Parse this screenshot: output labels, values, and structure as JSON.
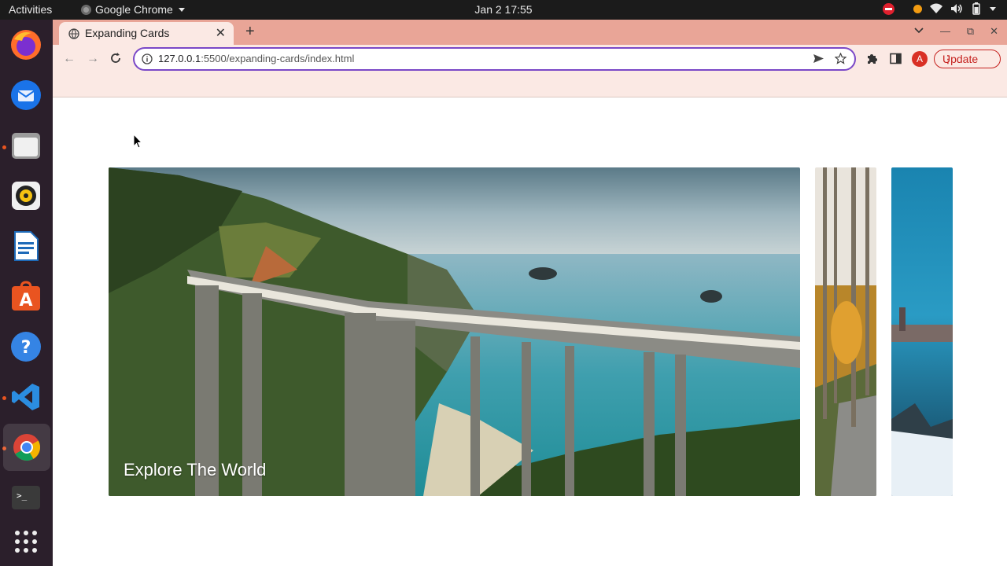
{
  "system": {
    "activities": "Activities",
    "app_name": "Google Chrome",
    "clock": "Jan 2  17:55"
  },
  "browser": {
    "tab_title": "Expanding Cards",
    "url_host": "127.0.0.1",
    "url_path": ":5500/expanding-cards/index.html",
    "avatar_letter": "A",
    "update_label": "Update"
  },
  "page": {
    "cards": [
      {
        "title": "Explore The World",
        "active": true
      },
      {
        "title": "",
        "active": false
      },
      {
        "title": "",
        "active": false
      }
    ]
  },
  "dock": {
    "apps": [
      "firefox-icon",
      "thunderbird-icon",
      "files-icon",
      "rhythmbox-icon",
      "writer-icon",
      "software-icon",
      "help-icon",
      "vscode-icon",
      "chrome-icon",
      "terminal-icon",
      "app-grid-icon"
    ]
  },
  "colors": {
    "tabstrip": "#e9a597",
    "toolbar": "#fbe9e4",
    "omnibox_focus": "#7a48c7",
    "update": "#c5221f"
  }
}
